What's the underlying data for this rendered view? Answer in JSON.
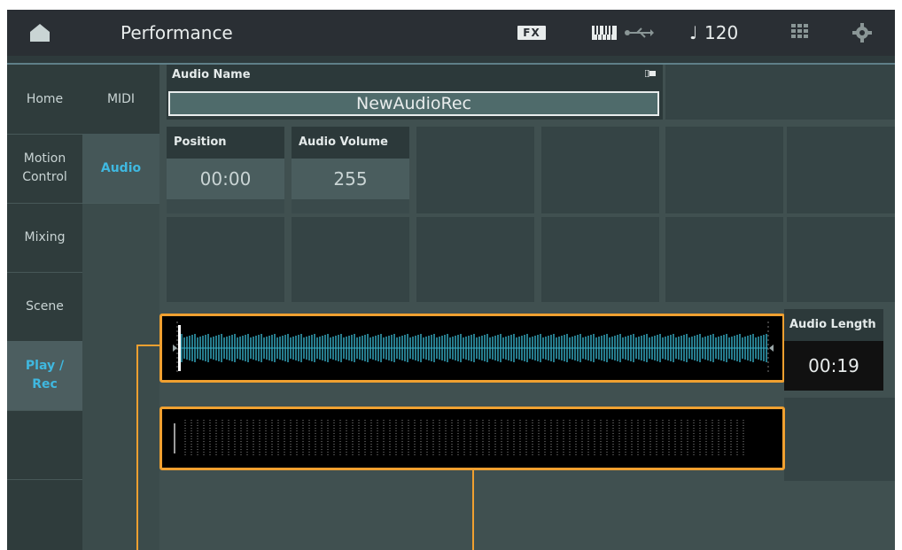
{
  "header": {
    "title": "Performance",
    "fx_label": "FX",
    "tempo": "120",
    "note_glyph": "♩"
  },
  "left_nav": {
    "items": [
      {
        "label": "Home"
      },
      {
        "label": "Motion Control"
      },
      {
        "label": "Mixing"
      },
      {
        "label": "Scene"
      },
      {
        "label": "Play / Rec",
        "active": true
      }
    ]
  },
  "sub_nav": {
    "items": [
      {
        "label": "MIDI"
      },
      {
        "label": "Audio",
        "active": true
      }
    ]
  },
  "audio_name": {
    "label": "Audio Name",
    "value": "NewAudioRec"
  },
  "position": {
    "label": "Position",
    "value": "00:00"
  },
  "audio_volume": {
    "label": "Audio Volume",
    "value": "255"
  },
  "audio_length": {
    "label": "Audio Length",
    "value": "00:19"
  },
  "colors": {
    "accent": "#3fb8e0",
    "callout": "#f0a030",
    "waveform": "#36b0c8"
  }
}
